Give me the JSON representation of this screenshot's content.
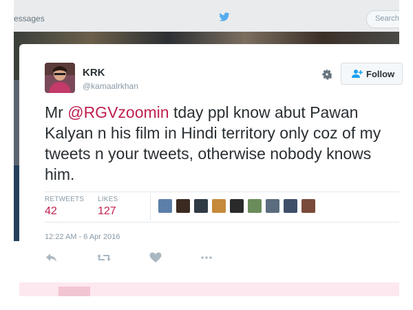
{
  "background_page": {
    "nav_text": "essages",
    "search_placeholder": "Search"
  },
  "tweet": {
    "author_name": "KRK",
    "author_handle": "@kamaalrkhan",
    "follow_label": "Follow",
    "text_prefix": "Mr ",
    "mention": "@RGVzoomin",
    "text_suffix": " tday ppl know abut Pawan Kalyan n his film in Hindi territory only coz of my tweets n your tweets, otherwise nobody knows him.",
    "stats": {
      "retweets_label": "RETWEETS",
      "retweets_value": "42",
      "likes_label": "LIKES",
      "likes_value": "127"
    },
    "likers": [
      {
        "name": "liker-avatar-1",
        "color": "#5b7fa8"
      },
      {
        "name": "liker-avatar-2",
        "color": "#3a2a20"
      },
      {
        "name": "liker-avatar-3",
        "color": "#2f3a44"
      },
      {
        "name": "liker-avatar-4",
        "color": "#c58a3a"
      },
      {
        "name": "liker-avatar-5",
        "color": "#2a2a2a"
      },
      {
        "name": "liker-avatar-6",
        "color": "#6a8c5a"
      },
      {
        "name": "liker-avatar-7",
        "color": "#5a6c7e"
      },
      {
        "name": "liker-avatar-8",
        "color": "#3f4f6a"
      },
      {
        "name": "liker-avatar-9",
        "color": "#7a4a3a"
      }
    ],
    "timestamp": "12:22 AM - 6 Apr 2016",
    "actions": [
      "reply-icon",
      "retweet-icon",
      "like-heart-icon",
      "more-dots-icon"
    ]
  },
  "colors": {
    "accent": "#c0204f",
    "text": "#292f33",
    "muted": "#8899a6",
    "divider": "#e1e8ed"
  }
}
